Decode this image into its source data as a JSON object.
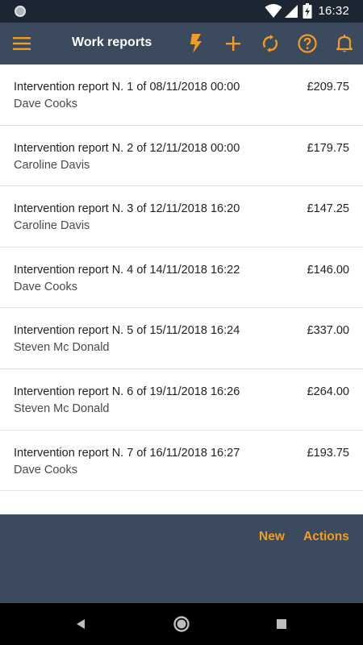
{
  "status_bar": {
    "time": "16:32",
    "icons": [
      "notification-dot-icon",
      "wifi-icon",
      "signal-icon",
      "battery-icon"
    ]
  },
  "app_bar": {
    "title": "Work reports",
    "icons": [
      "menu-icon",
      "flash-icon",
      "add-icon",
      "sync-icon",
      "help-icon",
      "bell-icon"
    ],
    "accent_color": "#f39c22",
    "background_color": "#3b4a5c"
  },
  "reports": [
    {
      "title": "Intervention report N. 1 of 08/11/2018 00:00",
      "client": "Dave Cooks",
      "amount": "£209.75"
    },
    {
      "title": "Intervention report N. 2 of 12/11/2018 00:00",
      "client": "Caroline Davis",
      "amount": "£179.75"
    },
    {
      "title": "Intervention report N. 3 of 12/11/2018 16:20",
      "client": "Caroline Davis",
      "amount": "£147.25"
    },
    {
      "title": "Intervention report N. 4 of 14/11/2018 16:22",
      "client": "Dave Cooks",
      "amount": "£146.00"
    },
    {
      "title": "Intervention report N. 5 of 15/11/2018 16:24",
      "client": "Steven Mc Donald",
      "amount": "£337.00"
    },
    {
      "title": "Intervention report N. 6 of 19/11/2018 16:26",
      "client": "Steven Mc Donald",
      "amount": "£264.00"
    },
    {
      "title": "Intervention report N. 7 of 16/11/2018 16:27",
      "client": "Dave Cooks",
      "amount": "£193.75"
    }
  ],
  "bottom_panel": {
    "new_label": "New",
    "actions_label": "Actions"
  },
  "nav_bar": {
    "icons": [
      "back-icon",
      "home-icon",
      "recents-icon"
    ]
  }
}
